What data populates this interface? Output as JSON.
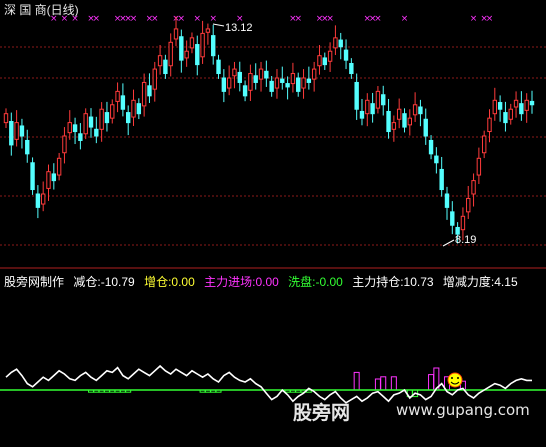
{
  "header": {
    "title": "深 国 商(日线)"
  },
  "main_chart": {
    "high_label": "13.12",
    "low_label": "8.19",
    "marker_glyph": "×",
    "colors": {
      "up": "#ff3b3b",
      "down": "#54ffff",
      "marker": "#ff33ff",
      "grid": "#8b1a1a"
    }
  },
  "indicator": {
    "name": "股旁网制作",
    "items": [
      {
        "label": "减仓:-10.79",
        "color": "#ffffff"
      },
      {
        "label": "增仓:0.00",
        "color": "#ffff33"
      },
      {
        "label": "主力进场:0.00",
        "color": "#ff33ff"
      },
      {
        "label": "洗盘:-0.00",
        "color": "#33ff33"
      },
      {
        "label": "主力持仓:10.73",
        "color": "#ffffff"
      },
      {
        "label": "增减力度:4.15",
        "color": "#ffffff"
      }
    ],
    "colors": {
      "line": "#ffffff",
      "zero": "#33ff33",
      "bar_up": "#ff33ff",
      "bar_down": "#33ff33"
    }
  },
  "watermark": {
    "text": "股旁网",
    "url": "www.gupang.com"
  },
  "chart_data": {
    "type": "candlestick",
    "ylim": [
      8.0,
      13.2
    ],
    "annotations": [
      {
        "text": "13.12",
        "value": 13.12,
        "kind": "high"
      },
      {
        "text": "8.19",
        "value": 8.19,
        "kind": "low"
      }
    ],
    "closes": [
      11.1,
      10.4,
      10.9,
      10.6,
      10.2,
      9.4,
      9.0,
      9.3,
      9.8,
      9.6,
      10.1,
      10.6,
      10.9,
      10.7,
      10.5,
      11.1,
      10.8,
      10.6,
      11.2,
      10.9,
      11.3,
      11.6,
      11.2,
      10.9,
      11.4,
      11.1,
      11.8,
      11.5,
      12.1,
      12.4,
      12.0,
      12.7,
      13.0,
      12.3,
      12.5,
      12.8,
      12.2,
      12.9,
      13.0,
      12.4,
      12.0,
      11.6,
      11.9,
      12.1,
      11.8,
      11.5,
      12.0,
      11.8,
      12.1,
      11.9,
      11.6,
      11.9,
      11.8,
      11.7,
      12.0,
      11.6,
      11.9,
      11.8,
      12.1,
      12.4,
      12.2,
      12.5,
      12.8,
      12.6,
      12.3,
      12.0,
      11.2,
      11.0,
      11.4,
      11.1,
      11.6,
      11.3,
      10.7,
      10.9,
      11.2,
      10.8,
      11.0,
      11.3,
      11.1,
      10.6,
      10.2,
      10.0,
      9.4,
      9.0,
      8.6,
      8.4,
      8.8,
      9.2,
      9.6,
      10.1,
      10.6,
      11.0,
      11.4,
      11.2,
      10.9,
      11.2,
      11.4,
      11.1,
      11.4,
      11.3
    ],
    "indicator_line": [
      8,
      11,
      13,
      9,
      4,
      2,
      5,
      8,
      6,
      9,
      12,
      10,
      7,
      6,
      9,
      11,
      8,
      6,
      9,
      12,
      11,
      14,
      9,
      7,
      10,
      13,
      11,
      9,
      12,
      15,
      12,
      10,
      13,
      11,
      9,
      12,
      10,
      8,
      10,
      7,
      5,
      9,
      11,
      8,
      6,
      5,
      7,
      4,
      2,
      -2,
      -6,
      -4,
      0,
      -3,
      -7,
      -4,
      -2,
      1,
      -1,
      -4,
      -6,
      -3,
      -1,
      -5,
      -8,
      -6,
      -4,
      -7,
      -5,
      -2,
      -1,
      -4,
      -7,
      -3,
      -2,
      0,
      -5,
      -2,
      -3,
      -6,
      -4,
      1,
      4,
      -1,
      -3,
      0,
      1,
      -3,
      -5,
      -2,
      0,
      2,
      4,
      3,
      1,
      4,
      6,
      7,
      6,
      6
    ],
    "indicator_bars": [
      {
        "index": 16,
        "value": -1
      },
      {
        "index": 17,
        "value": -1
      },
      {
        "index": 18,
        "value": -1
      },
      {
        "index": 19,
        "value": -1
      },
      {
        "index": 20,
        "value": -1
      },
      {
        "index": 21,
        "value": -1
      },
      {
        "index": 22,
        "value": -1
      },
      {
        "index": 23,
        "value": -1
      },
      {
        "index": 37,
        "value": -1
      },
      {
        "index": 38,
        "value": -1
      },
      {
        "index": 39,
        "value": -1
      },
      {
        "index": 40,
        "value": -1
      },
      {
        "index": 53,
        "value": -1
      },
      {
        "index": 54,
        "value": -1
      },
      {
        "index": 55,
        "value": -1
      },
      {
        "index": 56,
        "value": -1
      },
      {
        "index": 57,
        "value": -1
      },
      {
        "index": 66,
        "value": 8
      },
      {
        "index": 70,
        "value": 5
      },
      {
        "index": 71,
        "value": 6
      },
      {
        "index": 73,
        "value": 6
      },
      {
        "index": 76,
        "value": -3
      },
      {
        "index": 77,
        "value": -3
      },
      {
        "index": 80,
        "value": 7
      },
      {
        "index": 81,
        "value": 10
      },
      {
        "index": 83,
        "value": 6
      },
      {
        "index": 86,
        "value": 4
      }
    ],
    "marker_indices": [
      9,
      11,
      13,
      16,
      17,
      21,
      22,
      23,
      24,
      27,
      28,
      32,
      33,
      36,
      39,
      44,
      54,
      55,
      59,
      60,
      61,
      68,
      69,
      70,
      75,
      88,
      90,
      91
    ]
  }
}
